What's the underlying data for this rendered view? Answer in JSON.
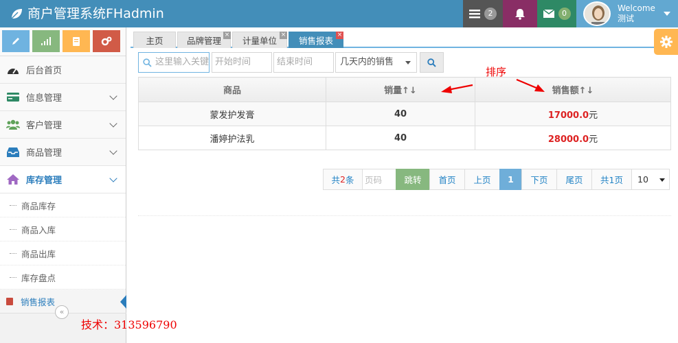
{
  "app": {
    "title": "商户管理系统FHadmin"
  },
  "header": {
    "tasks_count": "2",
    "messages_count": "0",
    "welcome": "Welcome",
    "username": "测试"
  },
  "sidebar": {
    "items": [
      {
        "label": "后台首页",
        "icon": "dashboard-icon"
      },
      {
        "label": "信息管理",
        "icon": "credit-card-icon"
      },
      {
        "label": "客户管理",
        "icon": "users-icon"
      },
      {
        "label": "商品管理",
        "icon": "inbox-icon"
      },
      {
        "label": "库存管理",
        "icon": "home-icon"
      }
    ],
    "subitems": [
      "商品库存",
      "商品入库",
      "商品出库",
      "库存盘点",
      "销售报表"
    ],
    "collapse_glyph": "«"
  },
  "tabs": [
    "主页",
    "品牌管理",
    "计量单位",
    "销售报表"
  ],
  "toolbar": {
    "search_placeholder": "这里输入关键词",
    "start_placeholder": "开始时间",
    "end_placeholder": "结束时间",
    "period_select": "几天内的销售"
  },
  "annotation": "排序",
  "table": {
    "headers": [
      "商品",
      "销量↑↓",
      "销售额↑↓"
    ],
    "rows": [
      {
        "product": "蒙发护发膏",
        "qty": "40",
        "amount": "17000.0",
        "unit": "元"
      },
      {
        "product": "潘婷护法乳",
        "qty": "40",
        "amount": "28000.0",
        "unit": "元"
      }
    ]
  },
  "pager": {
    "total_prefix": "共",
    "total_count": "2",
    "total_suffix": "条",
    "page_input_placeholder": "页码",
    "jump": "跳转",
    "first": "首页",
    "prev": "上页",
    "current": "1",
    "next": "下页",
    "last": "尾页",
    "pages": "共1页",
    "page_size": "10"
  },
  "watermark": "技术：313596790",
  "colors": {
    "header": "#438eb9",
    "accent_red": "#dd2222",
    "annotation_red": "#e00000"
  }
}
